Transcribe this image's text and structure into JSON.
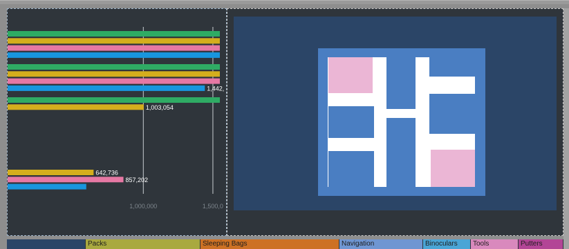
{
  "chart_data": {
    "type": "bar",
    "orientation": "horizontal",
    "title": "",
    "xlabel": "",
    "ylabel": "",
    "xlim": [
      0,
      1550000
    ],
    "x_ticks": [
      "1,000,000",
      "1,500,0"
    ],
    "grid": true,
    "colors": {
      "green": "#2fab64",
      "yellow": "#d4ae1d",
      "pink": "#e678a4",
      "blue": "#1896de"
    },
    "groups": [
      {
        "bars": [
          {
            "color": "green",
            "value": 1550000
          },
          {
            "color": "yellow",
            "value": 1550000
          },
          {
            "color": "pink",
            "value": 1550000
          },
          {
            "color": "blue",
            "value": 1550000
          }
        ]
      },
      {
        "bars": [
          {
            "color": "green",
            "value": 1550000
          },
          {
            "color": "yellow",
            "value": 1550000
          },
          {
            "color": "pink",
            "value": 1550000
          },
          {
            "color": "blue",
            "value": 1442000,
            "label": "1,442,"
          }
        ]
      },
      {
        "bars": [
          {
            "color": "green",
            "value": 1550000
          },
          {
            "color": "yellow",
            "value": 1003054,
            "label": "1,003,054"
          }
        ]
      },
      {
        "bars": [
          {
            "color": "yellow",
            "value": 642736,
            "label": "642,736"
          },
          {
            "color": "pink",
            "value": 857202,
            "label": "857,202"
          },
          {
            "color": "blue",
            "value": 590000
          }
        ]
      }
    ]
  },
  "treemap": {
    "colors": {
      "blue": "#4a7ec2",
      "pink": "#ebb6d5",
      "separator": "#ffffff"
    }
  },
  "legend": {
    "items": [
      {
        "label": "",
        "color": "#2b4567"
      },
      {
        "label": "Packs",
        "color": "#a9a93f"
      },
      {
        "label": "Sleeping Bags",
        "color": "#cd7124"
      },
      {
        "label": "Navigation",
        "color": "#6f96d2"
      },
      {
        "label": "Binoculars",
        "color": "#4aa5d6"
      },
      {
        "label": "Tools",
        "color": "#d989bd"
      },
      {
        "label": "Putters",
        "color": "#b34596"
      }
    ]
  }
}
